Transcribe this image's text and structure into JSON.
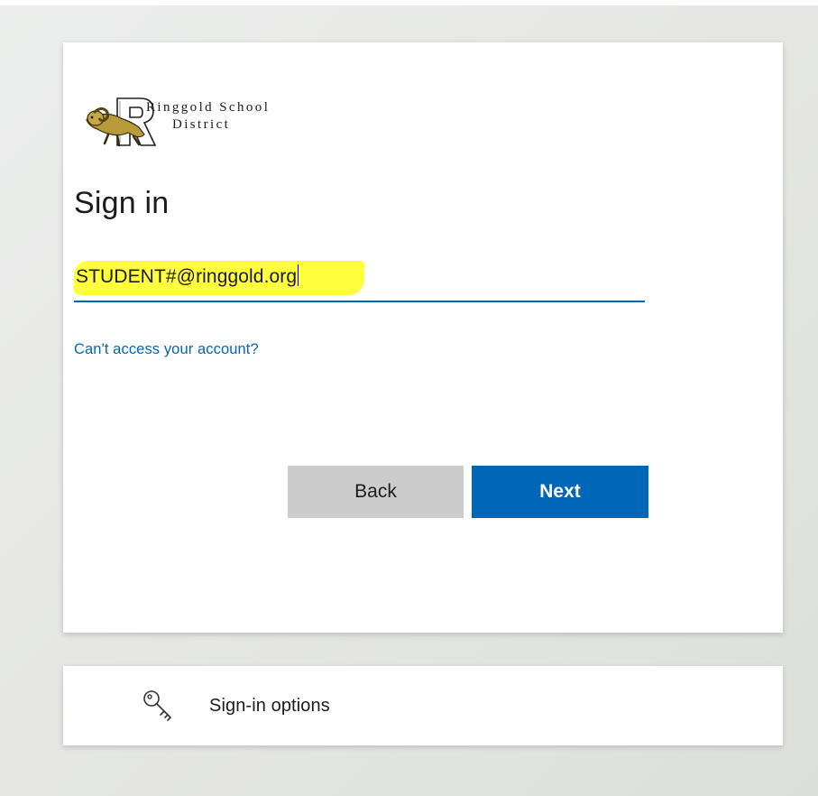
{
  "logo": {
    "line1": "Ringgold School",
    "line2": "District",
    "icon": "ram-mascot-r-logo"
  },
  "title": "Sign in",
  "email_input": {
    "value": "STUDENT#@ringgold.org",
    "highlight_color": "#ffff3b"
  },
  "help_link": "Can't access your account?",
  "buttons": {
    "back_label": "Back",
    "next_label": "Next"
  },
  "sign_in_options": {
    "label": "Sign-in options",
    "icon": "key-icon"
  },
  "colors": {
    "accent": "#0067b8",
    "back_button": "#cccccc",
    "text": "#1b1b1b"
  }
}
